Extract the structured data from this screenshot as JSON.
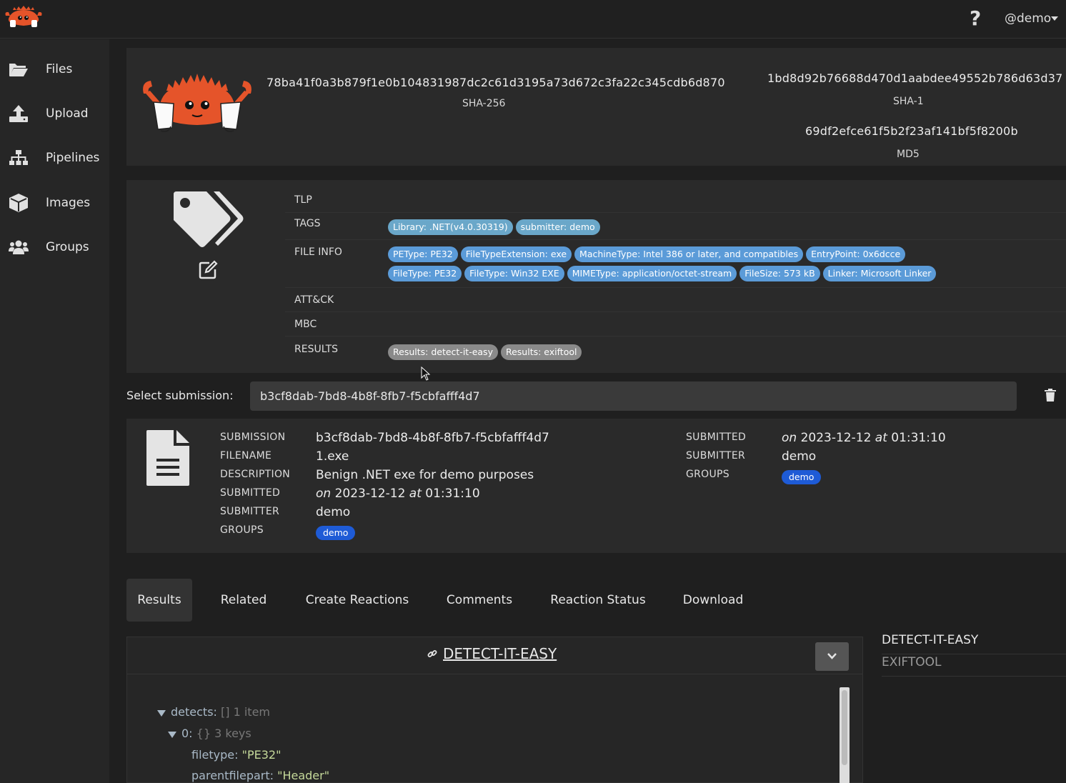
{
  "header": {
    "user_label": "@demo",
    "help_label": "?"
  },
  "sidebar": {
    "items": [
      {
        "label": "Files",
        "icon": "folder-open-icon"
      },
      {
        "label": "Upload",
        "icon": "upload-icon"
      },
      {
        "label": "Pipelines",
        "icon": "sitemap-icon"
      },
      {
        "label": "Images",
        "icon": "cube-icon"
      },
      {
        "label": "Groups",
        "icon": "users-icon"
      }
    ]
  },
  "hashes": {
    "sha256": "78ba41f0a3b879f1e0b104831987dc2c61d3195a73d672c3fa22c345cdb6d870",
    "sha256_label": "SHA-256",
    "sha1": "1bd8d92b76688d470d1aabdee49552b786d63d37",
    "sha1_label": "SHA-1",
    "md5": "69df2efce61f5b2f23af141bf5f8200b",
    "md5_label": "MD5"
  },
  "tags": {
    "tlp_label": "TLP",
    "tags_label": "TAGS",
    "tags": [
      "Library: .NET(v4.0.30319)",
      "submitter: demo"
    ],
    "fileinfo_label": "FILE INFO",
    "fileinfo": [
      "PEType: PE32",
      "FileTypeExtension: exe",
      "MachineType: Intel 386 or later, and compatibles",
      "EntryPoint: 0x6dcce",
      "FileType: PE32",
      "FileType: Win32 EXE",
      "MIMEType: application/octet-stream",
      "FileSize: 573 kB",
      "Linker: Microsoft Linker"
    ],
    "attck_label": "ATT&CK",
    "mbc_label": "MBC",
    "results_label": "RESULTS",
    "results": [
      "Results: detect-it-easy",
      "Results: exiftool"
    ]
  },
  "submission_select": {
    "label": "Select submission:",
    "value": "b3cf8dab-7bd8-4b8f-8fb7-f5cbfafff4d7"
  },
  "submission": {
    "left": {
      "submission_key": "SUBMISSION",
      "submission_val": "b3cf8dab-7bd8-4b8f-8fb7-f5cbfafff4d7",
      "filename_key": "FILENAME",
      "filename_val": "1.exe",
      "description_key": "DESCRIPTION",
      "description_val": "Benign .NET exe for demo purposes",
      "submitted_key": "SUBMITTED",
      "on": "on",
      "date": "2023-12-12",
      "at": "at",
      "time": "01:31:10",
      "submitter_key": "SUBMITTER",
      "submitter_val": "demo",
      "groups_key": "GROUPS",
      "group": "demo"
    },
    "right": {
      "submitted_key": "SUBMITTED",
      "on": "on",
      "date": "2023-12-12",
      "at": "at",
      "time": "01:31:10",
      "submitter_key": "SUBMITTER",
      "submitter_val": "demo",
      "groups_key": "GROUPS",
      "group": "demo"
    }
  },
  "tabs": [
    "Results",
    "Related",
    "Create Reactions",
    "Comments",
    "Reaction Status",
    "Download"
  ],
  "result": {
    "title": "DETECT-IT-EASY",
    "json": {
      "detects_key": "detects:",
      "detects_meta_bracket": "[]",
      "detects_meta_count": "1 item",
      "idx_key": "0:",
      "idx_meta_bracket": "{}",
      "idx_meta_count": "3 keys",
      "filetype_key": "filetype:",
      "filetype_val": "\"PE32\"",
      "parent_key": "parentfilepart:",
      "parent_val": "\"Header\""
    }
  },
  "result_list": [
    "DETECT-IT-EASY",
    "EXIFTOOL"
  ],
  "colors": {
    "accent_blue": "#1e5bd6",
    "tag_blue": "#5b9bd8",
    "tag_grey": "#8a8a8a",
    "mascot_orange": "#e5542a"
  }
}
